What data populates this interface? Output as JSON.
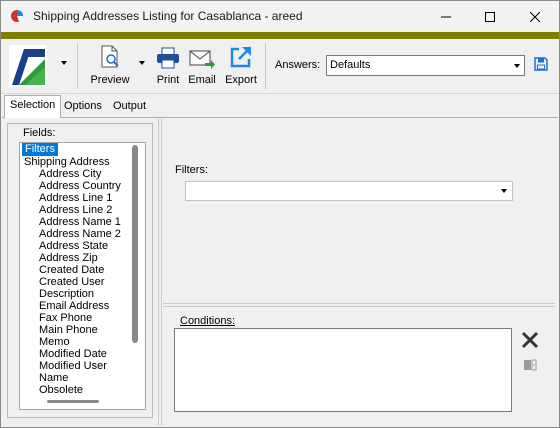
{
  "window": {
    "title": "Shipping Addresses Listing for Casablanca - areed",
    "icon": "pie-chart-icon"
  },
  "toolbar": {
    "preview_label": "Preview",
    "print_label": "Print",
    "email_label": "Email",
    "export_label": "Export",
    "answers_label": "Answers:",
    "answers_value": "Defaults"
  },
  "tabs": [
    {
      "label": "Selection",
      "active": true
    },
    {
      "label": "Options",
      "active": false
    },
    {
      "label": "Output",
      "active": false
    }
  ],
  "fields": {
    "label": "Fields:",
    "items": [
      {
        "label": "Filters",
        "level": 0,
        "selected": true
      },
      {
        "label": "Shipping Address",
        "level": 1
      },
      {
        "label": "Address City",
        "level": 2
      },
      {
        "label": "Address Country",
        "level": 2
      },
      {
        "label": "Address Line 1",
        "level": 2
      },
      {
        "label": "Address Line 2",
        "level": 2
      },
      {
        "label": "Address Name 1",
        "level": 2
      },
      {
        "label": "Address Name 2",
        "level": 2
      },
      {
        "label": "Address State",
        "level": 2
      },
      {
        "label": "Address Zip",
        "level": 2
      },
      {
        "label": "Created Date",
        "level": 2
      },
      {
        "label": "Created User",
        "level": 2
      },
      {
        "label": "Description",
        "level": 2
      },
      {
        "label": "Email Address",
        "level": 2
      },
      {
        "label": "Fax Phone",
        "level": 2
      },
      {
        "label": "Main Phone",
        "level": 2
      },
      {
        "label": "Memo",
        "level": 2
      },
      {
        "label": "Modified Date",
        "level": 2
      },
      {
        "label": "Modified User",
        "level": 2
      },
      {
        "label": "Name",
        "level": 2
      },
      {
        "label": "Obsolete",
        "level": 2
      }
    ]
  },
  "filters": {
    "label": "Filters:",
    "value": ""
  },
  "conditions": {
    "label": "Conditions:"
  },
  "colors": {
    "accent_bar": "#808000",
    "selection": "#0078d7",
    "export_icon": "#1e88e5",
    "save_icon": "#1e6fd9"
  }
}
